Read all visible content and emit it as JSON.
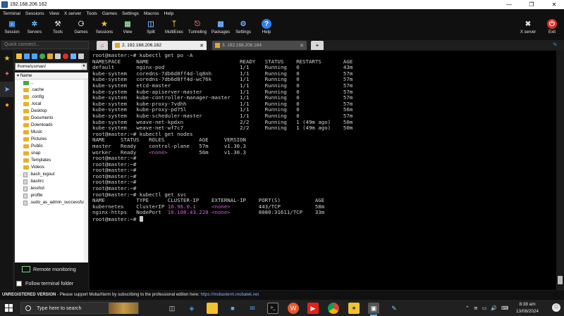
{
  "window": {
    "title": "192.168.206.162"
  },
  "menu": [
    "Terminal",
    "Sessions",
    "View",
    "X server",
    "Tools",
    "Games",
    "Settings",
    "Macros",
    "Help"
  ],
  "toolbar": {
    "buttons": [
      "Session",
      "Servers",
      "Tools",
      "Games",
      "Sessions",
      "View",
      "Split",
      "MultiExec",
      "Tunneling",
      "Packages",
      "Settings",
      "Help"
    ],
    "xserver": "X server",
    "exit": "Exit"
  },
  "quick_connect": {
    "placeholder": "Quick connect..."
  },
  "sftp": {
    "path": "/home/usman/",
    "column_header": "Name",
    "items": [
      {
        "name": "..",
        "kind": "up"
      },
      {
        "name": ".cache",
        "kind": "folder"
      },
      {
        "name": ".config",
        "kind": "folder"
      },
      {
        "name": ".local",
        "kind": "folder"
      },
      {
        "name": "Desktop",
        "kind": "folder"
      },
      {
        "name": "Documents",
        "kind": "folder"
      },
      {
        "name": "Downloads",
        "kind": "folder"
      },
      {
        "name": "Music",
        "kind": "folder"
      },
      {
        "name": "Pictures",
        "kind": "folder"
      },
      {
        "name": "Public",
        "kind": "folder"
      },
      {
        "name": "snap",
        "kind": "folder"
      },
      {
        "name": "Templates",
        "kind": "folder"
      },
      {
        "name": "Videos",
        "kind": "folder"
      },
      {
        "name": ".bash_logout",
        "kind": "file"
      },
      {
        "name": ".bashrc",
        "kind": "file"
      },
      {
        "name": ".lesshst",
        "kind": "file"
      },
      {
        "name": ".profile",
        "kind": "file"
      },
      {
        "name": ".sudo_as_admin_successful",
        "kind": "file"
      }
    ],
    "remote_monitoring": "Remote monitoring",
    "follow_folder": "Follow terminal folder"
  },
  "tabs": [
    {
      "label": "2. 192.168.206.162",
      "active": true
    },
    {
      "label": "3. 192.168.206.164",
      "active": false
    }
  ],
  "terminal": {
    "prompt": "root@master:~#",
    "cmd_pods": "kubectl get po -A",
    "pods_header": [
      "NAMESPACE",
      "NAME",
      "READY",
      "STATUS",
      "RESTARTS",
      "AGE"
    ],
    "pods": [
      [
        "default",
        "nginx-pod",
        "1/1",
        "Running",
        "0",
        "43m"
      ],
      [
        "kube-system",
        "coredns-7db6d8ff4d-lq8nh",
        "1/1",
        "Running",
        "0",
        "57m"
      ],
      [
        "kube-system",
        "coredns-7db6d8ff4d-wc76k",
        "1/1",
        "Running",
        "0",
        "57m"
      ],
      [
        "kube-system",
        "etcd-master",
        "1/1",
        "Running",
        "0",
        "57m"
      ],
      [
        "kube-system",
        "kube-apiserver-master",
        "1/1",
        "Running",
        "0",
        "57m"
      ],
      [
        "kube-system",
        "kube-controller-manager-master",
        "1/1",
        "Running",
        "0",
        "57m"
      ],
      [
        "kube-system",
        "kube-proxy-7vdhh",
        "1/1",
        "Running",
        "0",
        "57m"
      ],
      [
        "kube-system",
        "kube-proxy-pd75l",
        "1/1",
        "Running",
        "0",
        "56m"
      ],
      [
        "kube-system",
        "kube-scheduler-master",
        "1/1",
        "Running",
        "0",
        "57m"
      ],
      [
        "kube-system",
        "weave-net-kpdxn",
        "2/2",
        "Running",
        "1 (49m ago)",
        "50m"
      ],
      [
        "kube-system",
        "weave-net-wf7c7",
        "2/2",
        "Running",
        "1 (49m ago)",
        "50m"
      ]
    ],
    "cmd_nodes": "kubectl get nodes",
    "nodes_header": [
      "NAME",
      "STATUS",
      "ROLES",
      "AGE",
      "VERSION"
    ],
    "nodes": [
      [
        "master",
        "Ready",
        "control-plane",
        "57m",
        "v1.30.3"
      ],
      [
        "worker",
        "Ready",
        "<none>",
        "56m",
        "v1.30.3"
      ]
    ],
    "cmd_svc": "kubectl get svc",
    "svc_header": [
      "NAME",
      "TYPE",
      "CLUSTER-IP",
      "EXTERNAL-IP",
      "PORT(S)",
      "AGE"
    ],
    "svc": [
      [
        "kubernetes",
        "ClusterIP",
        "10.96.0.1",
        "<none>",
        "443/TCP",
        "58m"
      ],
      [
        "nginx-https",
        "NodePort",
        "10.108.43.228",
        "<none>",
        "8080:31611/TCP",
        "33m"
      ]
    ]
  },
  "statusbar": {
    "bold": "UNREGISTERED VERSION",
    "text": "  -  Please support MobaXterm by subscribing to the professional edition here:  ",
    "link": "https://mobaxterm.mobatek.net"
  },
  "taskbar": {
    "search_placeholder": "Type here to search",
    "time": "8:38 am",
    "date": "13/08/2024"
  }
}
